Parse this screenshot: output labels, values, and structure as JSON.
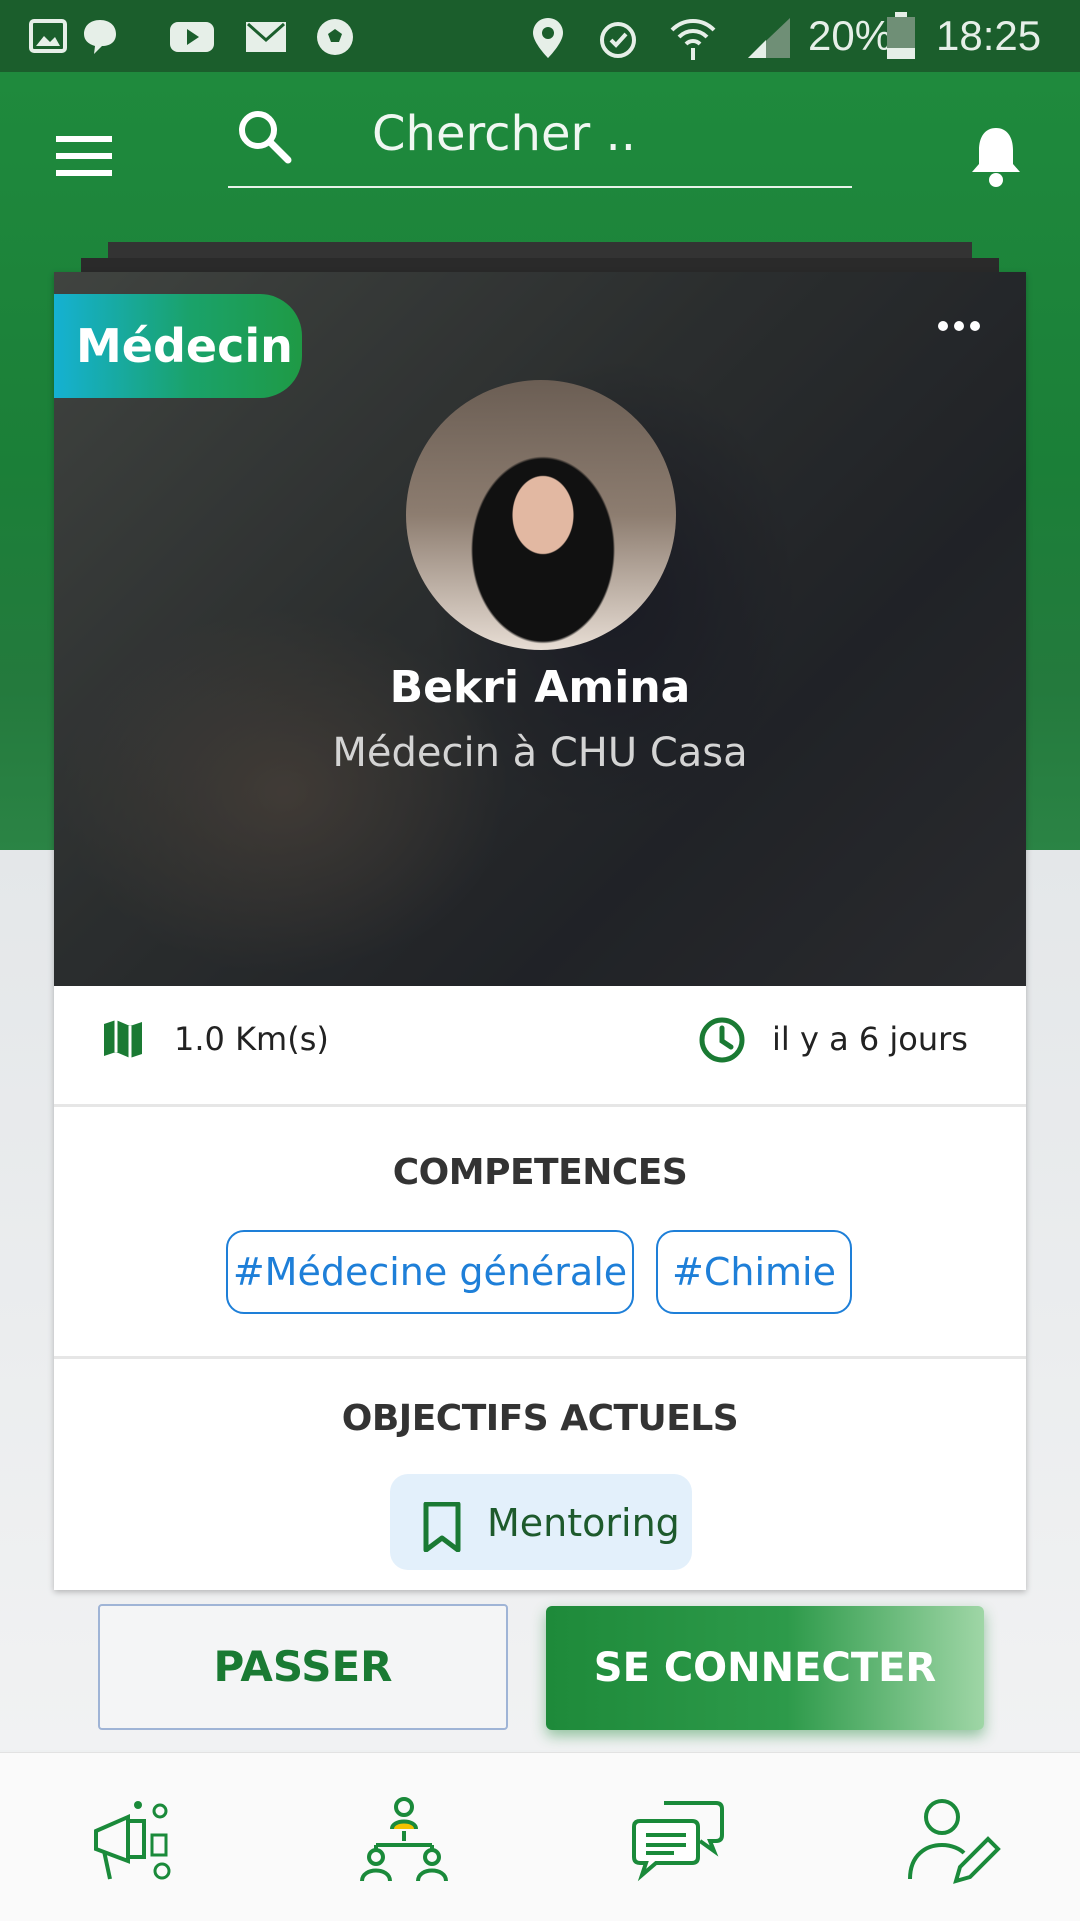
{
  "status_bar": {
    "battery": "20%",
    "time": "18:25",
    "icons": [
      "gallery-icon",
      "chat-bubble-icon",
      "youtube-icon",
      "mail-icon",
      "soccer-ball-icon",
      "location-pin-icon",
      "alarm-icon",
      "wifi-icon",
      "signal-icon",
      "battery-icon"
    ]
  },
  "toolbar": {
    "menu_icon": "menu-icon",
    "search_placeholder": "Chercher ..",
    "notification_icon": "bell-icon"
  },
  "card": {
    "badge": "Médecin",
    "more_icon": "more-dots-icon",
    "name": "Bekri Amina",
    "subtitle": "Médecin à CHU Casa",
    "distance": "1.0 Km(s)",
    "time_ago": "il y a  6 jours",
    "competences_title": "COMPETENCES",
    "competences": [
      "#Médecine générale",
      "#Chimie"
    ],
    "objectifs_title": "OBJECTIFS ACTUELS",
    "objectif": "Mentoring"
  },
  "actions": {
    "skip_label": "PASSER",
    "connect_label": "SE CONNECTER"
  },
  "bottom_nav": {
    "items": [
      "announce-icon",
      "network-icon",
      "messages-icon",
      "profile-edit-icon"
    ]
  },
  "colors": {
    "brand_green": "#1f8a3d",
    "status_bar": "#1b5e2c",
    "tag_blue": "#1e7fd8",
    "badge_cyan": "#15b1d2"
  }
}
